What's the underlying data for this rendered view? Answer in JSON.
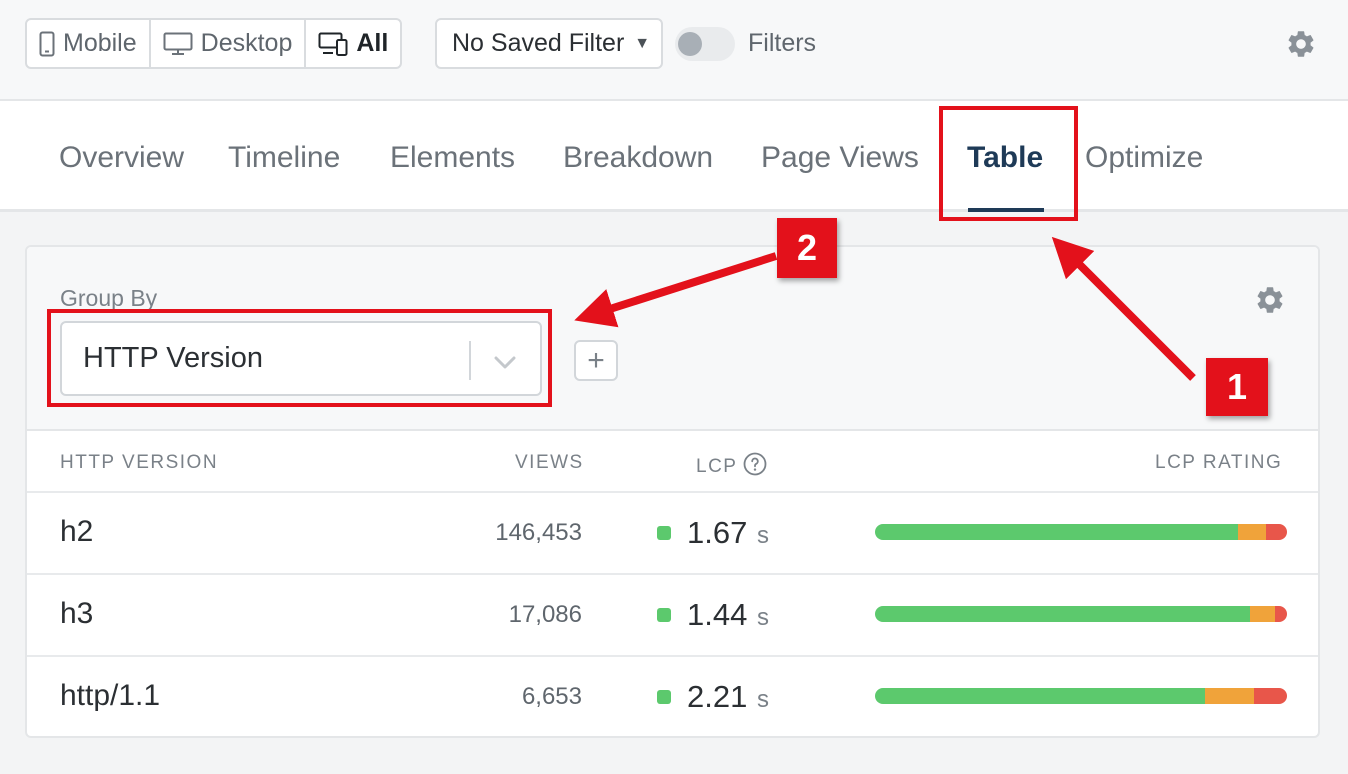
{
  "toolbar": {
    "device_buttons": [
      {
        "label": "Mobile",
        "icon": "mobile-icon",
        "active": false
      },
      {
        "label": "Desktop",
        "icon": "desktop-icon",
        "active": false
      },
      {
        "label": "All",
        "icon": "devices-icon",
        "active": true
      }
    ],
    "saved_filter": "No Saved Filter",
    "filters_label": "Filters",
    "filters_enabled": false
  },
  "tabs": [
    {
      "label": "Overview",
      "active": false
    },
    {
      "label": "Timeline",
      "active": false
    },
    {
      "label": "Elements",
      "active": false
    },
    {
      "label": "Breakdown",
      "active": false
    },
    {
      "label": "Page Views",
      "active": false
    },
    {
      "label": "Table",
      "active": true
    },
    {
      "label": "Optimize",
      "active": false
    }
  ],
  "card": {
    "group_by_label": "Group By",
    "group_by_value": "HTTP Version",
    "add_label": "+",
    "columns": [
      "HTTP VERSION",
      "VIEWS",
      "LCP",
      "LCP RATING"
    ],
    "rows": [
      {
        "name": "h2",
        "views": "146,453",
        "lcp": "1.67",
        "unit": "s",
        "rating": {
          "good": 0.88,
          "needs_improvement": 0.07,
          "poor": 0.05
        }
      },
      {
        "name": "h3",
        "views": "17,086",
        "lcp": "1.44",
        "unit": "s",
        "rating": {
          "good": 0.91,
          "needs_improvement": 0.06,
          "poor": 0.03
        }
      },
      {
        "name": "http/1.1",
        "views": "6,653",
        "lcp": "2.21",
        "unit": "s",
        "rating": {
          "good": 0.8,
          "needs_improvement": 0.12,
          "poor": 0.08
        }
      }
    ]
  },
  "annotations": {
    "badge_1": "1",
    "badge_2": "2"
  },
  "colors": {
    "accent": "#1e3a57",
    "good": "#5cc96d",
    "needs_improvement": "#f0a33a",
    "poor": "#e8564a",
    "annotation": "#e3111b"
  }
}
